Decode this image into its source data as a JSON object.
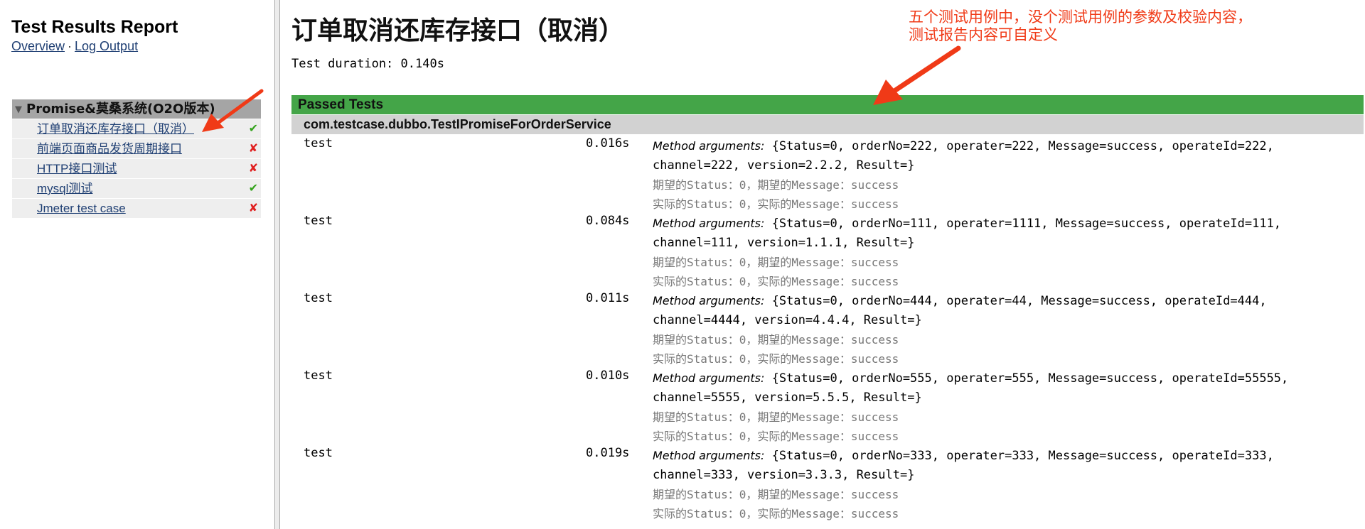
{
  "sidebar": {
    "title": "Test Results Report",
    "links": {
      "overview": "Overview",
      "separator": "·",
      "log_output": "Log Output"
    },
    "suite": {
      "name": "Promise&莫桑系统(O2O版本)",
      "collapse_glyph": "▼",
      "tests": [
        {
          "label": "订单取消还库存接口（取消）",
          "status_glyph": "✔",
          "status": "pass"
        },
        {
          "label": "前端页面商品发货周期接口",
          "status_glyph": "✘",
          "status": "fail"
        },
        {
          "label": "HTTP接口测试",
          "status_glyph": "✘",
          "status": "fail"
        },
        {
          "label": "mysql测试",
          "status_glyph": "✔",
          "status": "pass"
        },
        {
          "label": "Jmeter test case",
          "status_glyph": "✘",
          "status": "fail"
        }
      ]
    }
  },
  "main": {
    "title": "订单取消还库存接口（取消）",
    "duration": "Test duration: 0.140s",
    "passed_header": "Passed Tests",
    "class_name": "com.testcase.dubbo.TestIPromiseForOrderService",
    "results": [
      {
        "name": "test",
        "time": "0.016s",
        "args_label": "Method arguments:",
        "args": "{Status=0, orderNo=222, operater=222, Message=success, operateId=222, channel=222, version=2.2.2, Result=}",
        "expected": "期望的Status：0，期望的Message：success",
        "actual": "实际的Status：0，实际的Message：success"
      },
      {
        "name": "test",
        "time": "0.084s",
        "args_label": "Method arguments:",
        "args": "{Status=0, orderNo=111, operater=1111, Message=success, operateId=111, channel=111, version=1.1.1, Result=}",
        "expected": "期望的Status：0，期望的Message：success",
        "actual": "实际的Status：0，实际的Message：success"
      },
      {
        "name": "test",
        "time": "0.011s",
        "args_label": "Method arguments:",
        "args": "{Status=0, orderNo=444, operater=44, Message=success, operateId=444, channel=4444, version=4.4.4, Result=}",
        "expected": "期望的Status：0，期望的Message：success",
        "actual": "实际的Status：0，实际的Message：success"
      },
      {
        "name": "test",
        "time": "0.010s",
        "args_label": "Method arguments:",
        "args": "{Status=0, orderNo=555, operater=555, Message=success, operateId=55555, channel=5555, version=5.5.5, Result=}",
        "expected": "期望的Status：0，期望的Message：success",
        "actual": "实际的Status：0，实际的Message：success"
      },
      {
        "name": "test",
        "time": "0.019s",
        "args_label": "Method arguments:",
        "args": "{Status=0, orderNo=333, operater=333, Message=success, operateId=333, channel=333, version=3.3.3, Result=}",
        "expected": "期望的Status：0，期望的Message：success",
        "actual": "实际的Status：0，实际的Message：success"
      }
    ]
  },
  "annotation": {
    "line1": "五个测试用例中，没个测试用例的参数及校验内容，",
    "line2": "测试报告内容可自定义"
  },
  "colors": {
    "passed_green": "#44a548",
    "pass_check": "#34a31c",
    "fail_cross": "#e02020",
    "annotation_red": "#f03a17",
    "link_blue": "#1f3f73"
  }
}
